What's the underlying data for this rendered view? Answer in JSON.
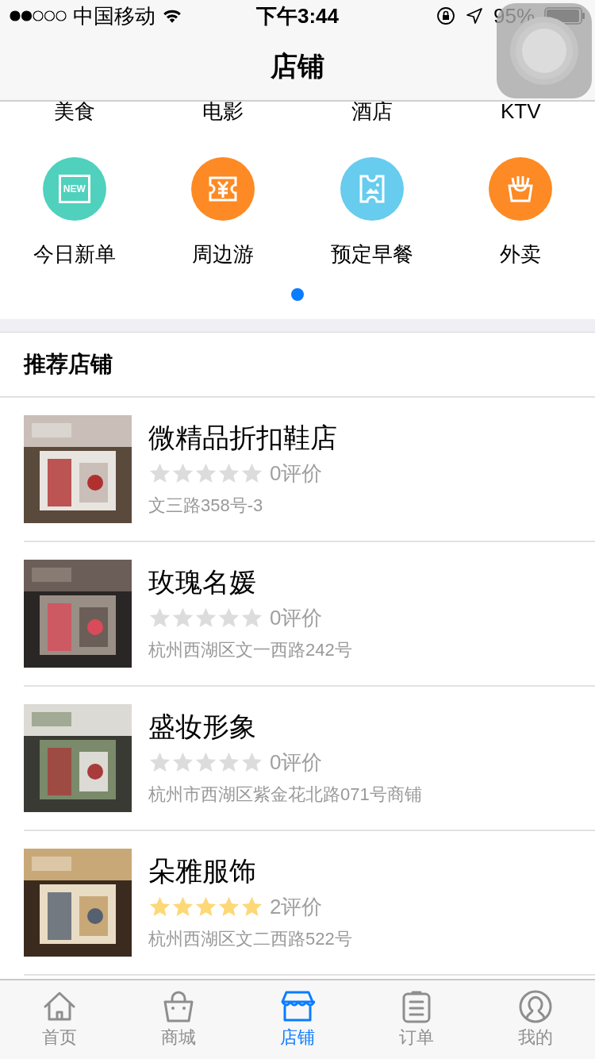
{
  "status_bar": {
    "carrier": "中国移动",
    "time": "下午3:44",
    "battery": "95%"
  },
  "nav": {
    "title": "店铺"
  },
  "categories_top": [
    "美食",
    "电影",
    "酒店",
    "KTV"
  ],
  "categories": [
    {
      "label": "今日新单",
      "color": "#4fd1bd",
      "icon_text": "NEW"
    },
    {
      "label": "周边游",
      "color": "#fd8a24"
    },
    {
      "label": "预定早餐",
      "color": "#67ccee"
    },
    {
      "label": "外卖",
      "color": "#fd8a24"
    }
  ],
  "page_dots": [
    {
      "selected": true
    }
  ],
  "section": {
    "title": "推荐店铺"
  },
  "shops": [
    {
      "name": "微精品折扣鞋店",
      "stars": 0,
      "reviews": "0评价",
      "address": "文三路358号-3"
    },
    {
      "name": "玫瑰名媛",
      "stars": 0,
      "reviews": "0评价",
      "address": "杭州西湖区文一西路242号"
    },
    {
      "name": "盛妆形象",
      "stars": 0,
      "reviews": "0评价",
      "address": "杭州市西湖区紫金花北路071号商铺"
    },
    {
      "name": "朵雅服饰",
      "stars": 5,
      "reviews": "2评价",
      "address": "杭州西湖区文二西路522号"
    }
  ],
  "tab_bar": [
    {
      "label": "首页",
      "selected": false
    },
    {
      "label": "商城",
      "selected": false
    },
    {
      "label": "店铺",
      "selected": true
    },
    {
      "label": "订单",
      "selected": false
    },
    {
      "label": "我的",
      "selected": false
    }
  ]
}
